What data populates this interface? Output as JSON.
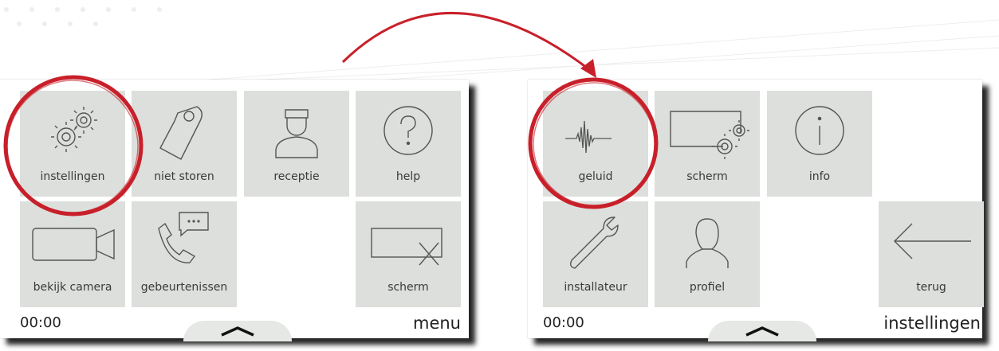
{
  "left_screen": {
    "tiles": [
      {
        "label": "instellingen",
        "icon": "gears-icon"
      },
      {
        "label": "niet storen",
        "icon": "door-hanger-icon"
      },
      {
        "label": "receptie",
        "icon": "receptionist-icon"
      },
      {
        "label": "help",
        "icon": "help-icon"
      },
      {
        "label": "bekijk camera",
        "icon": "camera-icon"
      },
      {
        "label": "gebeurtenissen",
        "icon": "phone-message-icon"
      },
      {
        "label": "scherm",
        "icon": "screen-off-icon"
      }
    ],
    "time": "00:00",
    "title": "menu"
  },
  "right_screen": {
    "tiles": [
      {
        "label": "geluid",
        "icon": "sound-wave-icon"
      },
      {
        "label": "scherm",
        "icon": "screen-settings-icon"
      },
      {
        "label": "info",
        "icon": "info-icon"
      },
      {
        "label": "installateur",
        "icon": "wrench-icon"
      },
      {
        "label": "profiel",
        "icon": "profile-icon"
      },
      {
        "label": "terug",
        "icon": "back-arrow-icon"
      }
    ],
    "time": "00:00",
    "title": "instellingen"
  },
  "colors": {
    "tile_background": "#dcdfdb",
    "highlight": "#c8202a",
    "text": "#3a3a3a"
  }
}
